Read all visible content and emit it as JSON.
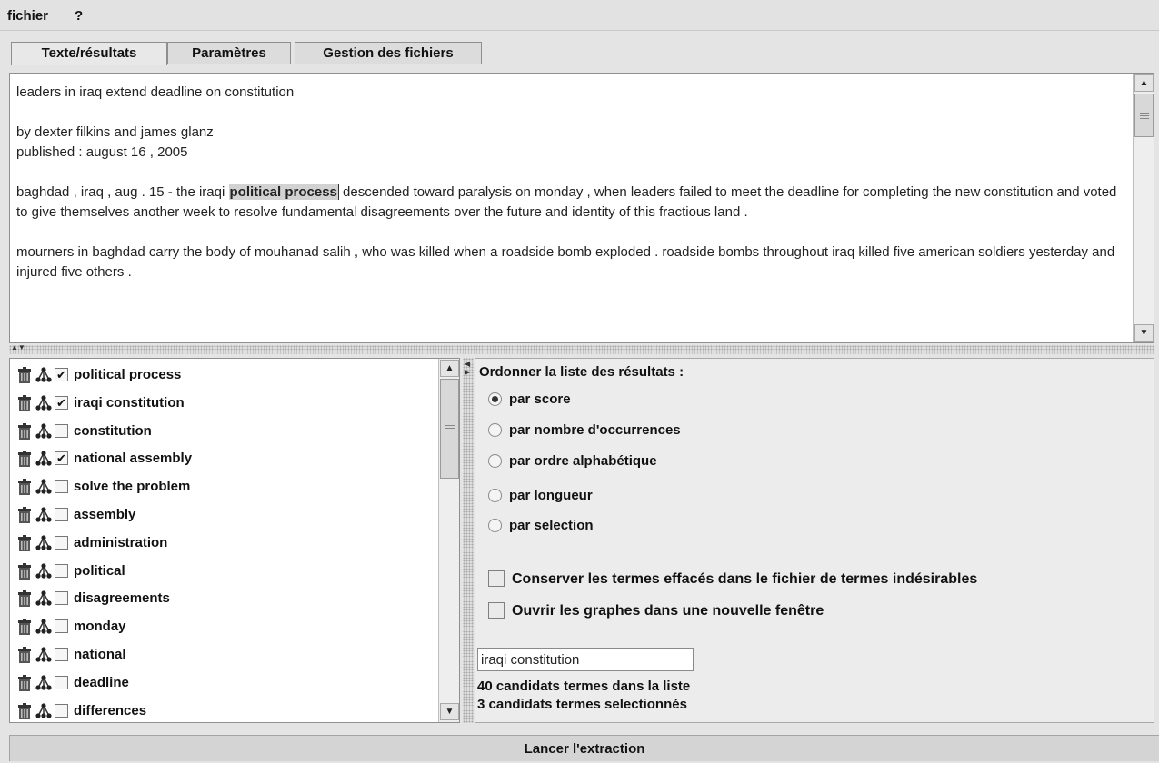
{
  "menu": {
    "file": "fichier",
    "help": "?"
  },
  "tabs": [
    {
      "label": "Texte/résultats",
      "active": true
    },
    {
      "label": "Paramètres",
      "active": false
    },
    {
      "label": "Gestion des fichiers",
      "active": false
    }
  ],
  "document": {
    "title": "leaders in iraq extend deadline on constitution",
    "byline": "by dexter filkins and james glanz",
    "published": "published : august 16 , 2005",
    "para1_before": "baghdad , iraq , aug . 15 - the iraqi ",
    "para1_highlight": "political process",
    "para1_after": " descended toward paralysis on monday , when leaders failed to meet the deadline for completing the new constitution and voted to give themselves another week to resolve fundamental disagreements over the future and identity of this fractious land .",
    "para2": "mourners in baghdad carry the body of mouhanad salih , who was killed when a roadside bomb exploded . roadside bombs throughout iraq killed five american soldiers yesterday and injured five others ."
  },
  "terms": [
    {
      "label": "political process",
      "checked": true
    },
    {
      "label": "iraqi constitution",
      "checked": true
    },
    {
      "label": "constitution",
      "checked": false
    },
    {
      "label": "national assembly",
      "checked": true
    },
    {
      "label": "solve the problem",
      "checked": false
    },
    {
      "label": "assembly",
      "checked": false
    },
    {
      "label": "administration",
      "checked": false
    },
    {
      "label": "political",
      "checked": false
    },
    {
      "label": "disagreements",
      "checked": false
    },
    {
      "label": "monday",
      "checked": false
    },
    {
      "label": "national",
      "checked": false
    },
    {
      "label": "deadline",
      "checked": false
    },
    {
      "label": "differences",
      "checked": false
    }
  ],
  "options": {
    "title": "Ordonner la liste des résultats :",
    "sort": [
      {
        "label": "par score",
        "selected": true
      },
      {
        "label": "par nombre d'occurrences",
        "selected": false
      },
      {
        "label": "par ordre alphabétique",
        "selected": false
      },
      {
        "label": "par longueur",
        "selected": false
      },
      {
        "label": "par selection",
        "selected": false
      }
    ],
    "keep_deleted": "Conserver les termes effacés dans le fichier de termes indésirables",
    "open_graphs": "Ouvrir les graphes dans une nouvelle fenêtre",
    "search_value": "iraqi constitution",
    "count_total": "40 candidats termes dans la liste",
    "count_selected": "3 candidats termes selectionnés"
  },
  "launch_label": "Lancer l'extraction",
  "icons": {
    "trash": "trash-icon",
    "tree": "tree-graph-icon"
  }
}
